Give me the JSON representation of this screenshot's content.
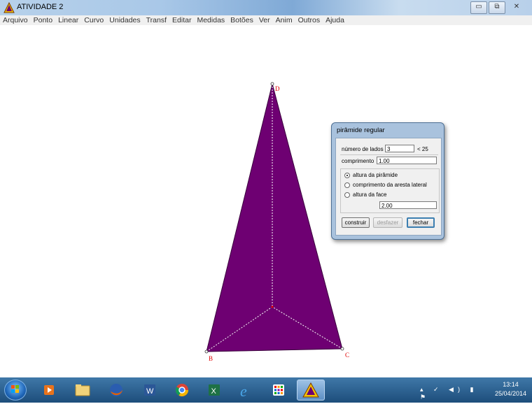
{
  "window": {
    "title": "ATIVIDADE 2",
    "buttons": [
      "minimize",
      "restore",
      "close"
    ]
  },
  "menu": [
    "Arquivo",
    "Ponto",
    "Linear",
    "Curvo",
    "Unidades",
    "Transf",
    "Editar",
    "Medidas",
    "Botões",
    "Ver",
    "Anim",
    "Outros",
    "Ajuda"
  ],
  "figure": {
    "label_d": "D",
    "label_b": "B",
    "label_c": "C",
    "fill_color": "#6e0072"
  },
  "dialog": {
    "title": "pirâmide regular",
    "sides_label": "número de lados",
    "sides_value": "3",
    "sides_limit": "< 25",
    "length_label": "comprimento",
    "length_value": "1.00",
    "options": [
      "altura da pirâmide",
      "comprimento da aresta lateral",
      "altura da face"
    ],
    "selected_option": "altura da pirâmide",
    "height_value": "2.00",
    "btn_construct": "construir",
    "btn_undo": "desfazer",
    "btn_close": "fechar"
  },
  "taskbar": {
    "time": "13:14",
    "date": "25/04/2014"
  }
}
